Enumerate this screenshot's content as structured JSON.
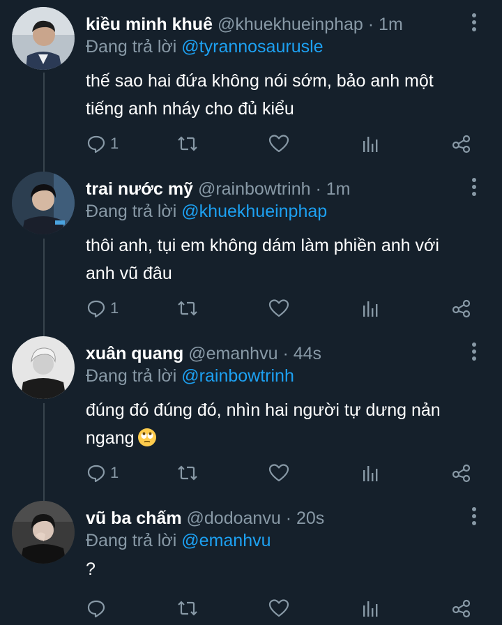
{
  "tweets": [
    {
      "name": "kiều minh khuê",
      "handle": "@khuekhueinphap",
      "time": "1m",
      "replying_label": "Đang trả lời",
      "replying_to": "@tyrannosaurusle",
      "text_lines": [
        "thế sao hai đứa không nói sớm, bảo anh một",
        "tiếng anh nháy cho đủ kiểu"
      ],
      "reply_count": "1"
    },
    {
      "name": "trai nước mỹ",
      "handle": "@rainbowtrinh",
      "time": "1m",
      "replying_label": "Đang trả lời",
      "replying_to": "@khuekhueinphap",
      "text_lines": [
        "thôi anh, tụi em không dám làm phiền anh với",
        "anh vũ đâu"
      ],
      "reply_count": "1"
    },
    {
      "name": "xuân quang",
      "handle": "@emanhvu",
      "time": "44s",
      "replying_label": "Đang trả lời",
      "replying_to": "@rainbowtrinh",
      "text_lines": [
        "đúng đó đúng đó, nhìn hai người tự dưng nản",
        "ngang"
      ],
      "reply_count": "1"
    },
    {
      "name": "vũ ba chấm",
      "handle": "@dodoanvu",
      "time": "20s",
      "replying_label": "Đang trả lời",
      "replying_to": "@emanhvu",
      "text_lines": [
        "?"
      ],
      "reply_count": ""
    }
  ],
  "icons": {
    "reply": "reply-icon",
    "retweet": "retweet-icon",
    "like": "heart-icon",
    "analytics": "analytics-icon",
    "share": "share-icon",
    "more": "more-vertical-icon",
    "emoji": "face-with-rolling-eyes-emoji"
  },
  "colors": {
    "background": "#15202b",
    "secondary_text": "#8899a6",
    "mention": "#1da1f2",
    "thread_line": "#38444d"
  }
}
